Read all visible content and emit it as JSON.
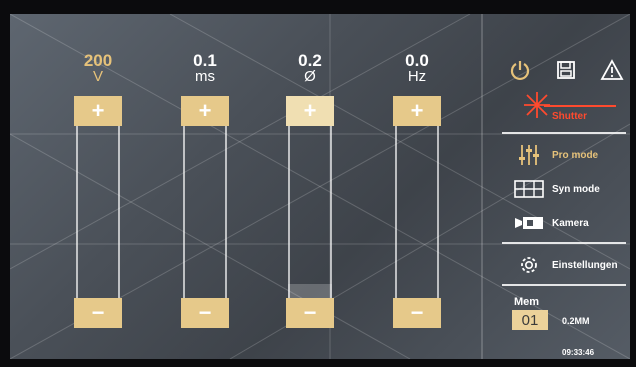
{
  "params": [
    {
      "value": "200",
      "unit": "V",
      "color": "#e6c27a"
    },
    {
      "value": "0.1",
      "unit": "ms",
      "color": "#ffffff"
    },
    {
      "value": "0.2",
      "unit": "Ø",
      "color": "#ffffff"
    },
    {
      "value": "0.0",
      "unit": "Hz",
      "color": "#ffffff"
    }
  ],
  "controls": {
    "plus": "+",
    "minus": "−"
  },
  "icons": [
    "power-icon",
    "save-icon",
    "warning-icon",
    "shutter-icon",
    "sliders-icon",
    "grid-icon",
    "camera-icon",
    "gear-icon"
  ],
  "sidebar": {
    "shutter_label": "Shutter",
    "modes": [
      {
        "label": "Pro mode",
        "active": true
      },
      {
        "label": "Syn mode",
        "active": false
      },
      {
        "label": "Kamera",
        "active": false
      },
      {
        "label": "Einstellungen",
        "active": false
      }
    ]
  },
  "memory": {
    "title": "Mem",
    "slot": "01",
    "value": "0.2MM"
  },
  "clock": "09:33:46",
  "colors": {
    "accent": "#e6c98a",
    "gold_text": "#e6c27a",
    "shutter_red": "#ff4a2e"
  }
}
